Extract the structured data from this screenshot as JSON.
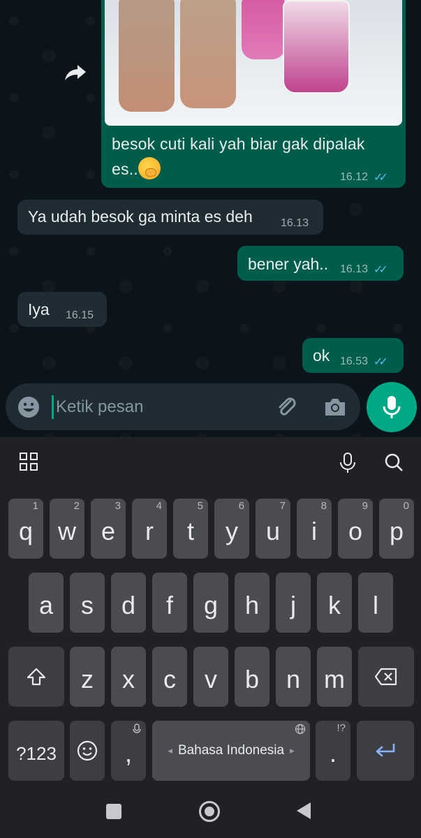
{
  "colors": {
    "chat_bg": "#0b141a",
    "outgoing_bubble": "#005c4b",
    "incoming_bubble": "#202c33",
    "accent_green": "#00a884",
    "read_ticks": "#53bdeb",
    "keyboard_bg": "#202124",
    "key_bg": "#4a4c51"
  },
  "messages": [
    {
      "direction": "outgoing",
      "type": "image",
      "caption_line1": "besok cuti kali yah biar gak dipalak",
      "caption_line2": "es..",
      "emoji": "face-with-hand-over-mouth",
      "time": "16.12",
      "status": "read"
    },
    {
      "direction": "incoming",
      "text": "Ya udah besok ga minta es deh",
      "time": "16.13"
    },
    {
      "direction": "outgoing",
      "text": "bener yah..",
      "time": "16.13",
      "status": "read"
    },
    {
      "direction": "incoming",
      "text": "Iya",
      "time": "16.15"
    },
    {
      "direction": "outgoing",
      "text": "ok",
      "time": "16.53",
      "status": "read"
    }
  ],
  "input": {
    "placeholder": "Ketik pesan"
  },
  "icons": {
    "forward": "forward-arrow-icon",
    "emoji": "smiley-icon",
    "attach": "paperclip-icon",
    "camera": "camera-icon",
    "mic": "microphone-icon"
  },
  "keyboard": {
    "row1": [
      {
        "k": "q",
        "h": "1"
      },
      {
        "k": "w",
        "h": "2"
      },
      {
        "k": "e",
        "h": "3"
      },
      {
        "k": "r",
        "h": "4"
      },
      {
        "k": "t",
        "h": "5"
      },
      {
        "k": "y",
        "h": "6"
      },
      {
        "k": "u",
        "h": "7"
      },
      {
        "k": "i",
        "h": "8"
      },
      {
        "k": "o",
        "h": "9"
      },
      {
        "k": "p",
        "h": "0"
      }
    ],
    "row2": [
      "a",
      "s",
      "d",
      "f",
      "g",
      "h",
      "j",
      "k",
      "l"
    ],
    "row3": [
      "z",
      "x",
      "c",
      "v",
      "b",
      "n",
      "m"
    ],
    "symbols_key": "?123",
    "comma_key": ",",
    "period_key": ".",
    "period_hint": "!?",
    "space_label": "Bahasa Indonesia",
    "space_arrow_left": "◂",
    "space_arrow_right": "▸"
  }
}
